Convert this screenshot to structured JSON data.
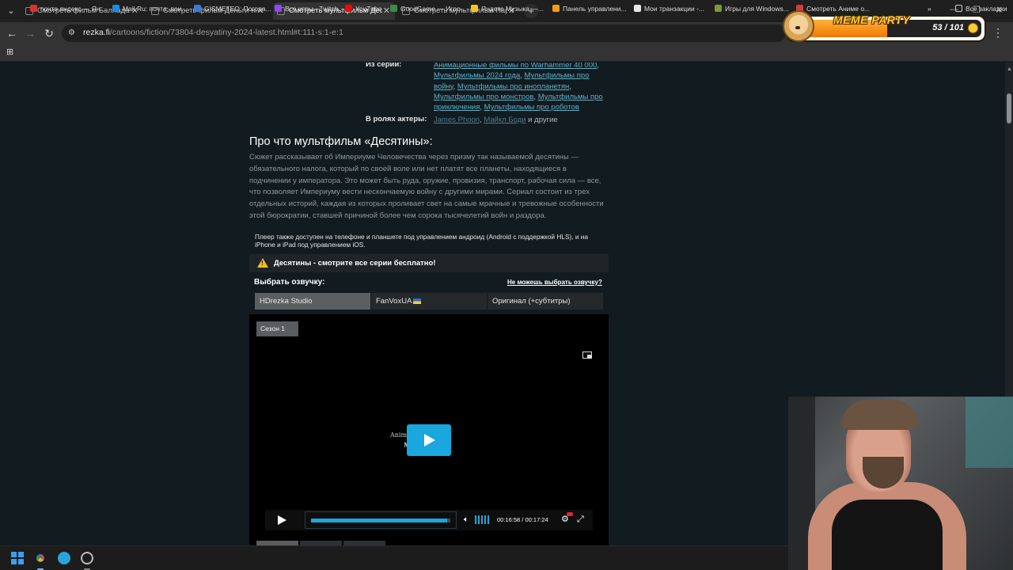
{
  "browser": {
    "tabs": [
      {
        "title": "Смотреть фильм Баллада о м",
        "active": false
      },
      {
        "title": "Смотреть фильм Деньги на д",
        "active": false
      },
      {
        "title": "Смотреть мультфильм Десяти",
        "active": true
      },
      {
        "title": "Смотреть мультфильм Пари",
        "active": false
      }
    ],
    "new_tab": "+",
    "url_host": "rezka.fi",
    "url_path": "/cartoons/fiction/73804-desyatiny-2024-latest.html#t:111-s:1-e:1",
    "bookmarks": [
      {
        "label": "почта яндекс — Ян...",
        "color": "#d8342c"
      },
      {
        "label": "Mail.Ru: почта, пои...",
        "color": "#168de2"
      },
      {
        "label": "GISMETEO: Погода...",
        "color": "#3a7ad8"
      },
      {
        "label": "Все игры - Twitch",
        "color": "#9146ff"
      },
      {
        "label": "YouTube",
        "color": "#ff0000"
      },
      {
        "label": "GoodGame — Игро...",
        "color": "#3a8a4a"
      },
      {
        "label": "Яндекс Музыка —...",
        "color": "#f5c518"
      },
      {
        "label": "Панель управлени...",
        "color": "#f39c12"
      },
      {
        "label": "Мои транзакции -...",
        "color": "#e6e6e6"
      },
      {
        "label": "Игры для Windows...",
        "color": "#7a9a3a"
      },
      {
        "label": "Смотреть Аниме о...",
        "color": "#d83a3a"
      }
    ],
    "all_bookmarks": "Все закладки"
  },
  "overlay": {
    "title": "MEME PARTY",
    "count": "53 / 101",
    "progress": 0.52
  },
  "page": {
    "series_label": "Из серии:",
    "series_links": [
      "Анимационные фильмы по Warhammer 40 000",
      "Мультфильмы 2024 года",
      "Мультфильмы про войну",
      "Мультфильмы про инопланетян",
      "Мультфильмы про монстров",
      "Мультфильмы про приключения",
      "Мультфильмы про роботов"
    ],
    "actors_label": "В ролях актеры:",
    "actors": [
      "James Phoon",
      "Майкл Боди"
    ],
    "actors_more": "и другие",
    "about_title": "Про что мультфильм «Десятины»:",
    "about_text": "Сюжет рассказывает об Империуме Человечества через призму так называемой десятины — обязательного налога, который по своей воле или нет платят все планеты, находящиеся в подчинении у императора. Это может быть руда, оружие, провизия, транспорт, рабочая сила — все, что позволяет Империуму вести нескончаемую войну с другими мирами. Сериал состоит из трех отдельных историй, каждая из которых проливает свет на самые мрачные и тревожные особенности этой бюрократии, ставшей причиной более чем сорока тысячелетий войн и раздора.",
    "player_note": "Плеер также доступен на телефоне и планшете под управлением андроид (Android с поддержкой HLS), и на iPhone и iPad под управлением iOS.",
    "warning": "Десятины - смотрите все серии бесплатно!",
    "voice_label": "Выбрать озвучку:",
    "voice_help": "Не можешь выбрать озвучку?",
    "voices": [
      "HDrezka Studio",
      "FanVoxUA",
      "Оригинал (+субтитры)"
    ],
    "selected_voice": 0
  },
  "player": {
    "season": "Сезон 1",
    "frame_text_1": "Anim                    on by",
    "frame_text_2": "M                  N",
    "current_time": "00:16:58",
    "duration": "00:17:24",
    "progress": 0.975,
    "volume": 1.0
  }
}
